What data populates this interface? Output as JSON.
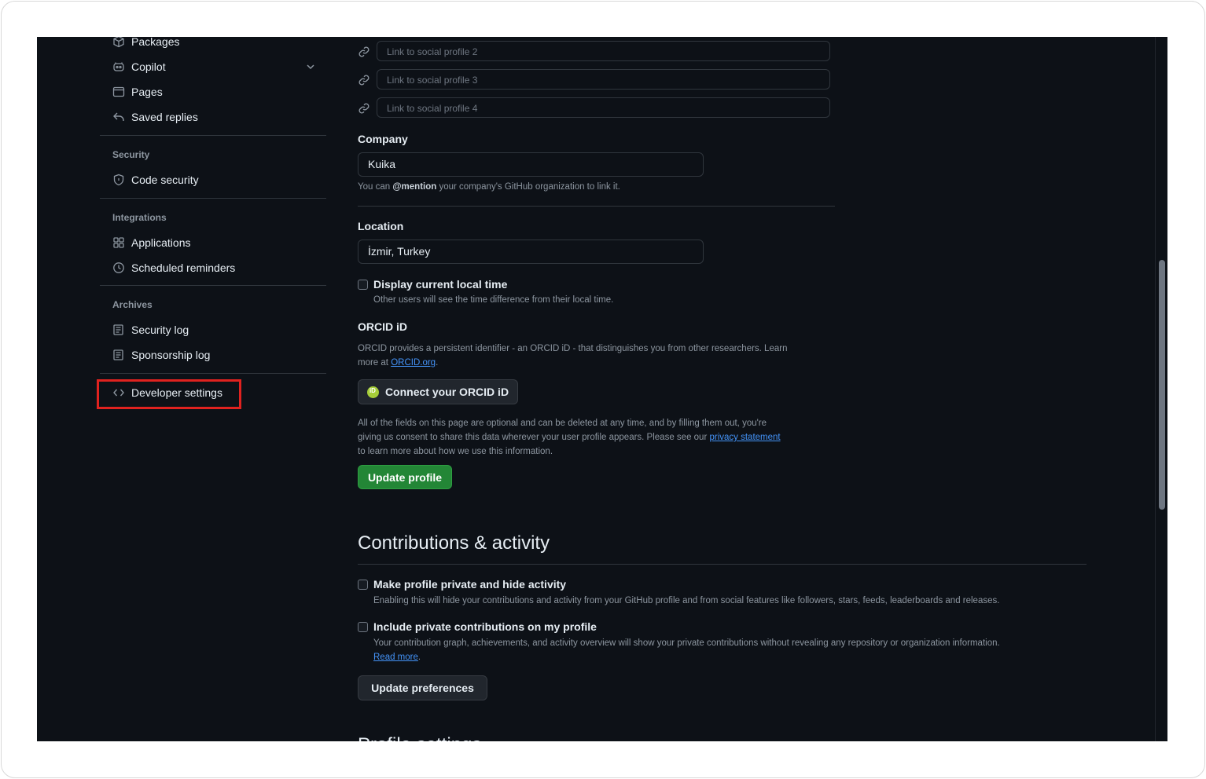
{
  "sidebar": {
    "items_top": [
      {
        "label": "Packages",
        "icon": "package-icon"
      },
      {
        "label": "Copilot",
        "icon": "copilot-icon"
      },
      {
        "label": "Pages",
        "icon": "browser-icon"
      },
      {
        "label": "Saved replies",
        "icon": "reply-icon"
      }
    ],
    "security": {
      "title": "Security",
      "items": [
        {
          "label": "Code security",
          "icon": "shield-icon"
        }
      ]
    },
    "integrations": {
      "title": "Integrations",
      "items": [
        {
          "label": "Applications",
          "icon": "apps-icon"
        },
        {
          "label": "Scheduled reminders",
          "icon": "clock-icon"
        }
      ]
    },
    "archives": {
      "title": "Archives",
      "items": [
        {
          "label": "Security log",
          "icon": "log-icon"
        },
        {
          "label": "Sponsorship log",
          "icon": "log-icon"
        }
      ]
    },
    "developer_settings": {
      "label": "Developer settings",
      "icon": "code-icon"
    }
  },
  "main": {
    "social_links": [
      {
        "placeholder": "Link to social profile 2"
      },
      {
        "placeholder": "Link to social profile 3"
      },
      {
        "placeholder": "Link to social profile 4"
      }
    ],
    "company": {
      "label": "Company",
      "value": "Kuika",
      "note_pre": "You can ",
      "note_mention": "@mention",
      "note_post": " your company's GitHub organization to link it."
    },
    "location": {
      "label": "Location",
      "value": "İzmir, Turkey"
    },
    "local_time": {
      "label": "Display current local time",
      "note": "Other users will see the time difference from their local time."
    },
    "orcid": {
      "title": "ORCID iD",
      "note_line1": "ORCID provides a persistent identifier - an ORCID iD - that distinguishes you from other researchers. Learn",
      "note_line2_pre": "more at ",
      "note_link": "ORCID.org",
      "note_line2_post": ".",
      "button": "Connect your ORCID iD"
    },
    "consent": {
      "line1": "All of the fields on this page are optional and can be deleted at any time, and by filling them out, you're",
      "line2_pre": "giving us consent to share this data wherever your user profile appears. Please see our ",
      "line2_link": "privacy statement",
      "line3": "to learn more about how we use this information."
    },
    "update_profile": "Update profile",
    "contributions": {
      "heading": "Contributions & activity",
      "private": {
        "label": "Make profile private and hide activity",
        "note": "Enabling this will hide your contributions and activity from your GitHub profile and from social features like followers, stars, feeds, leaderboards and releases."
      },
      "include_private": {
        "label": "Include private contributions on my profile",
        "note": "Your contribution graph, achievements, and activity overview will show your private contributions without revealing any repository or organization information.",
        "read_more": "Read more"
      },
      "update_button": "Update preferences"
    },
    "next_heading_partial": "Profile settings"
  }
}
